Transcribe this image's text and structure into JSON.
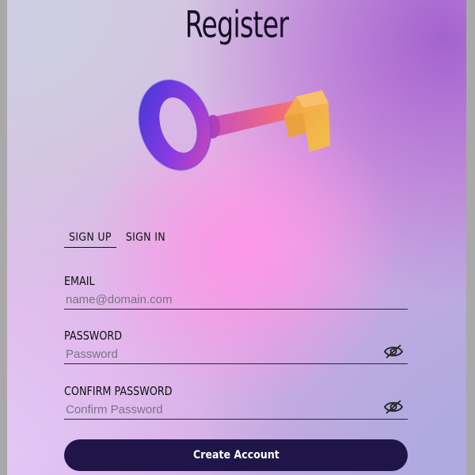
{
  "page": {
    "title": "Register"
  },
  "tabs": [
    {
      "label": "SIGN UP",
      "active": true
    },
    {
      "label": "SIGN IN",
      "active": false
    }
  ],
  "fields": {
    "email": {
      "label": "EMAIL",
      "placeholder": "name@domain.com",
      "value": ""
    },
    "password": {
      "label": "PASSWORD",
      "placeholder": "Password",
      "value": "",
      "icon": "eye-slash-icon"
    },
    "confirm_password": {
      "label": "CONFIRM PASSWORD",
      "placeholder": "Confirm Password",
      "value": "",
      "icon": "eye-slash-icon"
    }
  },
  "buttons": {
    "create_account": "Create Account"
  },
  "colors": {
    "button_bg": "#1f1548",
    "text": "#111111",
    "key_gradient_start": "#4a2fd6",
    "key_gradient_end": "#f2a13b"
  },
  "illustration": "key-3d-gradient"
}
